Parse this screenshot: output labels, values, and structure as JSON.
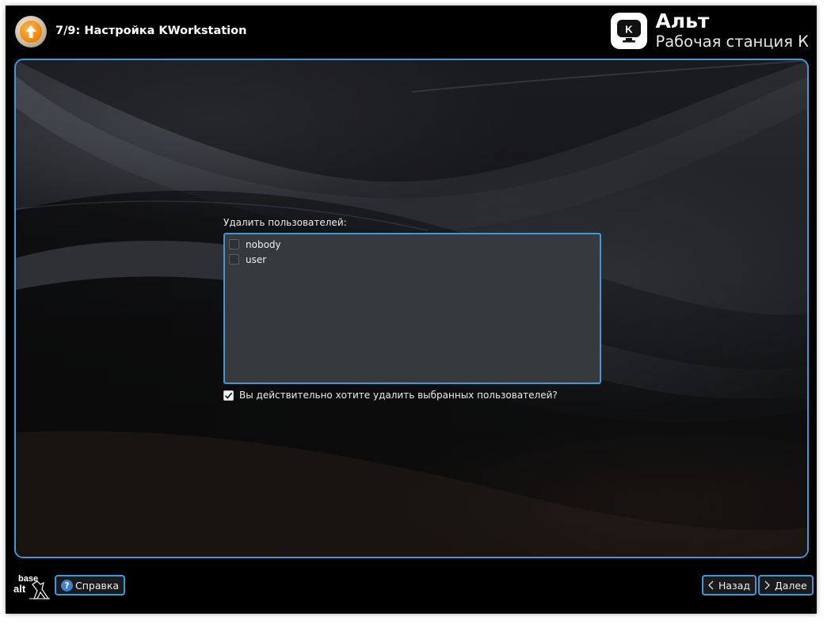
{
  "header": {
    "step_title": "7/9: Настройка KWorkstation",
    "step_icon": "up-arrow-icon"
  },
  "brand": {
    "logo_letter": "K",
    "name": "Альт",
    "subtitle": "Рабочая станция К"
  },
  "main": {
    "list_label": "Удалить пользователей:",
    "users": [
      {
        "name": "nobody",
        "checked": false
      },
      {
        "name": "user",
        "checked": false
      }
    ],
    "confirm": {
      "label": "Вы действительно хотите удалить выбранных пользователей?",
      "checked": true
    }
  },
  "footer": {
    "logo_text_top": "base",
    "logo_text_bottom": "alt",
    "help_label": "Справка",
    "back_label": "Назад",
    "next_label": "Далее"
  },
  "colors": {
    "accent": "#3d9ad6",
    "window_bg": "#000000",
    "list_bg": "#363a3f"
  }
}
